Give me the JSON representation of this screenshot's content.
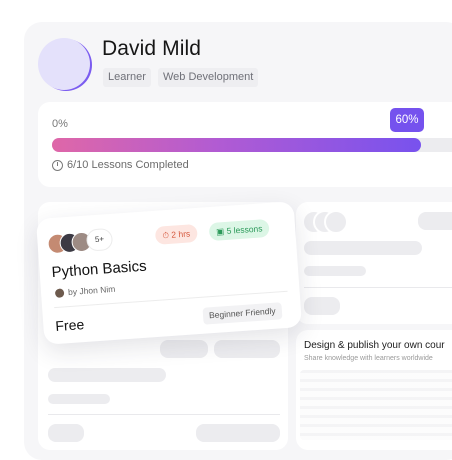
{
  "profile": {
    "name": "David Mild",
    "tags": [
      "Learner",
      "Web Development"
    ]
  },
  "progress": {
    "start_label": "0%",
    "current_label": "60%",
    "value": 0.9,
    "lessons_text": "6/10 Lessons Completed"
  },
  "course_card": {
    "enrolled_more": "5+",
    "duration": "2 hrs",
    "lessons": "5 lessons",
    "title": "Python Basics",
    "author": "by Jhon Nim",
    "price": "Free",
    "level": "Beginner Friendly"
  },
  "promo": {
    "title": "Design & publish your own cour",
    "subtitle": "Share knowledge with learners worldwide"
  },
  "colors": {
    "accent": "#7552ee",
    "gradient_start": "#df67a8",
    "duration_pill": "#fde6e1",
    "lessons_pill": "#dcf6e6"
  },
  "icons": {
    "lessons": "clock-icon",
    "duration": "timer-icon",
    "lessons_pill": "book-icon"
  }
}
